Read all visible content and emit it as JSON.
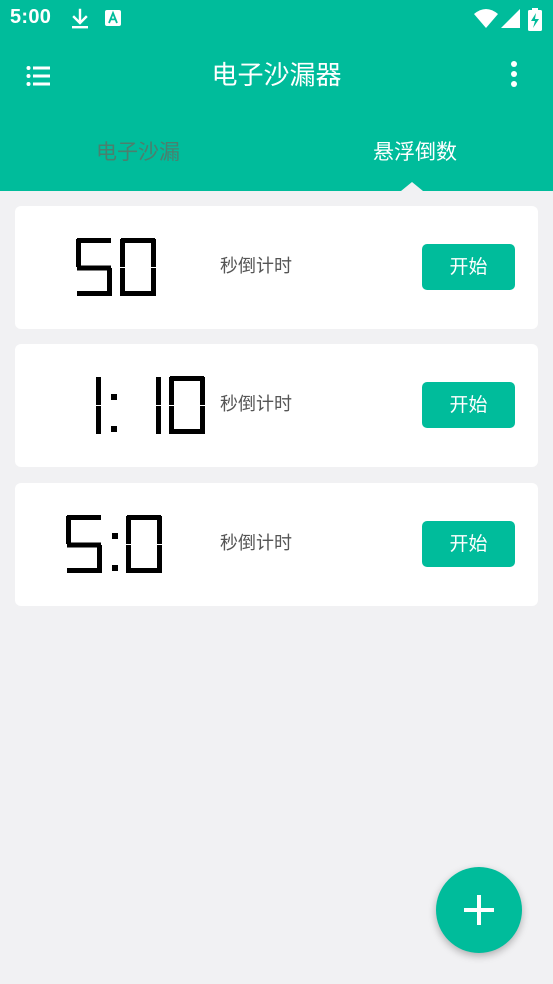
{
  "status_bar": {
    "time": "5:00",
    "icons": [
      "download-icon",
      "a-badge-icon",
      "wifi-icon",
      "signal-icon",
      "battery-charging-icon"
    ]
  },
  "app_bar": {
    "title": "电子沙漏器",
    "menu_icon": "menu-list-icon",
    "more_icon": "more-vert-icon"
  },
  "tabs": [
    {
      "label": "电子沙漏",
      "selected": false
    },
    {
      "label": "悬浮倒数",
      "selected": true
    }
  ],
  "timers": [
    {
      "display": "50",
      "label": "秒倒计时",
      "button": "开始"
    },
    {
      "display": "1:10",
      "label": "秒倒计时",
      "button": "开始"
    },
    {
      "display": "5:0",
      "label": "秒倒计时",
      "button": "开始"
    }
  ],
  "fab": {
    "icon": "plus-icon"
  },
  "colors": {
    "accent": "#00bc9b",
    "background": "#f1f1f3",
    "card": "#ffffff",
    "inactive_tab": "#4b7f6e",
    "label": "#555555"
  }
}
